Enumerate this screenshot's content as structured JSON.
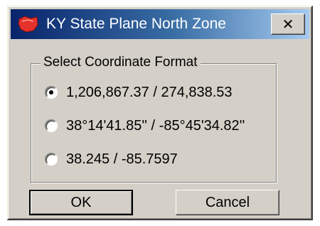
{
  "window": {
    "title": "KY State Plane North Zone",
    "close_icon": "close-icon"
  },
  "colors": {
    "titlebar_start": "#08246b",
    "titlebar_end": "#a6caf0",
    "face": "#d4d0c8",
    "app_icon": "#e5322d"
  },
  "group": {
    "legend": "Select Coordinate Format",
    "options": [
      {
        "label": "1,206,867.37 / 274,838.53",
        "selected": true
      },
      {
        "label": "38°14'41.85'' / -85°45'34.82''",
        "selected": false
      },
      {
        "label": "38.245 / -85.7597",
        "selected": false
      }
    ]
  },
  "buttons": {
    "ok_label": "OK",
    "cancel_label": "Cancel"
  }
}
